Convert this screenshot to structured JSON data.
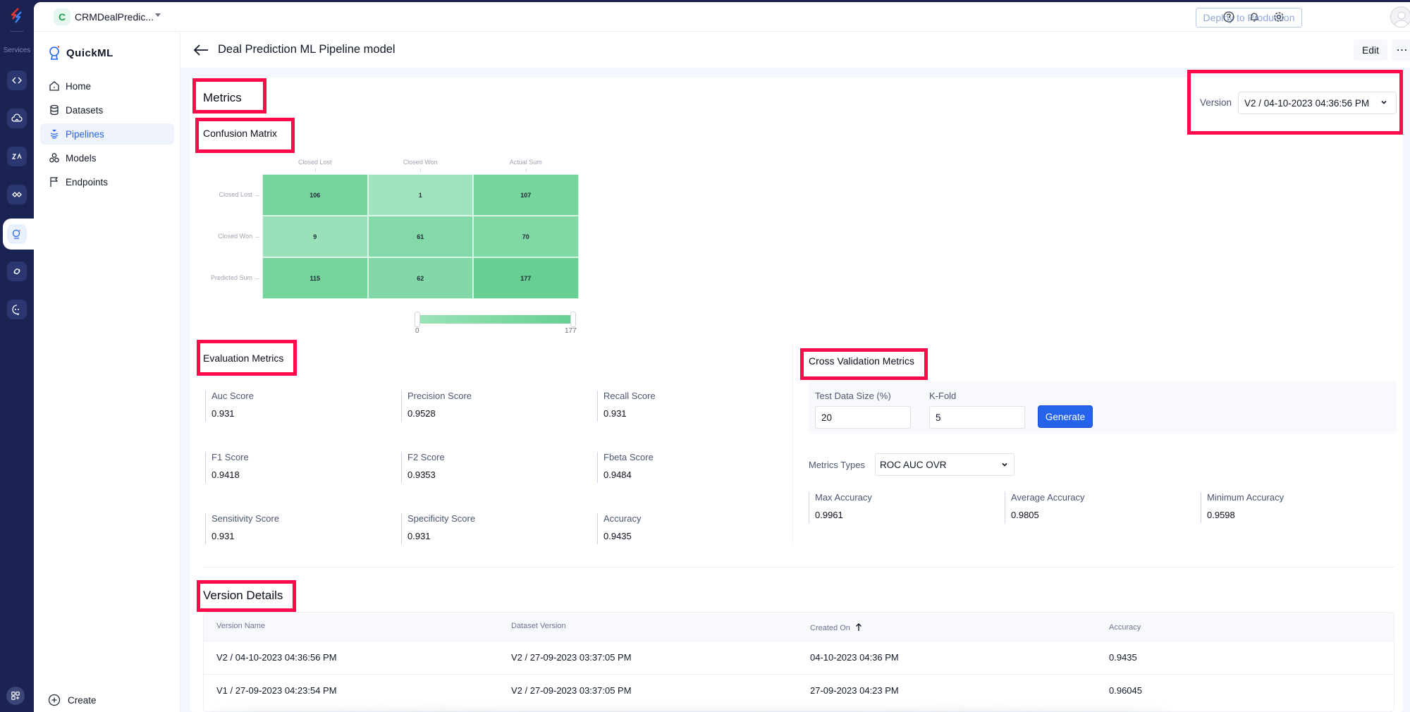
{
  "rail": {
    "services_label": "Services",
    "items": [
      {
        "icon": "code-icon"
      },
      {
        "icon": "cloud-icon"
      },
      {
        "icon": "zia-icon"
      },
      {
        "icon": "sync-icon"
      },
      {
        "icon": "quickml-icon",
        "active": true
      },
      {
        "icon": "link-icon"
      },
      {
        "icon": "chat-bot-icon"
      }
    ],
    "bottom_icon": "apps-add-icon"
  },
  "topbar": {
    "project_initial": "C",
    "project_name": "CRMDealPredic...",
    "deploy_label": "Deploy to Production",
    "icons": [
      "help-icon",
      "bell-icon",
      "gear-icon",
      "avatar"
    ]
  },
  "sidebar": {
    "brand": "QuickML",
    "items": [
      {
        "label": "Home",
        "icon": "home-icon"
      },
      {
        "label": "Datasets",
        "icon": "database-icon"
      },
      {
        "label": "Pipelines",
        "icon": "pipeline-icon",
        "active": true
      },
      {
        "label": "Models",
        "icon": "models-icon"
      },
      {
        "label": "Endpoints",
        "icon": "flag-icon"
      }
    ],
    "create_label": "Create"
  },
  "header": {
    "title": "Deal Prediction ML Pipeline model",
    "edit_label": "Edit",
    "more_label": "⋯"
  },
  "metrics": {
    "title": "Metrics",
    "version_label": "Version",
    "version_value": "V2 / 04-10-2023 04:36:56 PM",
    "confusion_matrix": {
      "title": "Confusion Matrix"
    },
    "evaluation": {
      "title": "Evaluation Metrics",
      "items": [
        {
          "label": "Auc Score",
          "value": "0.931"
        },
        {
          "label": "Precision Score",
          "value": "0.9528"
        },
        {
          "label": "Recall Score",
          "value": "0.931"
        },
        {
          "label": "F1 Score",
          "value": "0.9418"
        },
        {
          "label": "F2 Score",
          "value": "0.9353"
        },
        {
          "label": "Fbeta Score",
          "value": "0.9484"
        },
        {
          "label": "Sensitivity Score",
          "value": "0.931"
        },
        {
          "label": "Specificity Score",
          "value": "0.931"
        },
        {
          "label": "Accuracy",
          "value": "0.9435"
        }
      ]
    },
    "cross_validation": {
      "title": "Cross Validation Metrics",
      "test_size_label": "Test Data Size (%)",
      "test_size_value": "20",
      "kfold_label": "K-Fold",
      "kfold_value": "5",
      "generate_label": "Generate",
      "metrics_types_label": "Metrics Types",
      "metrics_types_value": "ROC AUC OVR",
      "stats": [
        {
          "label": "Max Accuracy",
          "value": "0.9961"
        },
        {
          "label": "Average Accuracy",
          "value": "0.9805"
        },
        {
          "label": "Minimum Accuracy",
          "value": "0.9598"
        }
      ]
    }
  },
  "version_details": {
    "title": "Version Details",
    "columns": [
      "Version Name",
      "Dataset Version",
      "Created On",
      "Accuracy"
    ],
    "sort_column": "Created On",
    "sort_direction": "ascending",
    "rows": [
      [
        "V2 / 04-10-2023 04:36:56 PM",
        "V2 / 27-09-2023 03:37:05 PM",
        "04-10-2023 04:36 PM",
        "0.9435"
      ],
      [
        "V1 / 27-09-2023 04:23:54 PM",
        "V2 / 27-09-2023 03:37:05 PM",
        "27-09-2023 04:23 PM",
        "0.96045"
      ]
    ]
  },
  "chart_data": {
    "type": "heatmap",
    "title": "Confusion Matrix",
    "x_categories": [
      "Closed Lost",
      "Closed Won",
      "Actual Sum"
    ],
    "y_categories": [
      "Closed Lost",
      "Closed Won",
      "Predicted Sum"
    ],
    "values": [
      [
        106,
        1,
        107
      ],
      [
        9,
        61,
        70
      ],
      [
        115,
        62,
        177
      ]
    ],
    "color_scale": {
      "min": 0,
      "max": 177,
      "min_color": "#a3e4c0",
      "max_color": "#66cf91"
    },
    "legend": {
      "min_label": "0",
      "max_label": "177",
      "placement": "bottom"
    }
  },
  "colors": {
    "accent": "#2563eb",
    "rail_bg": "#1b2352",
    "highlight": "#ff0a4a"
  }
}
